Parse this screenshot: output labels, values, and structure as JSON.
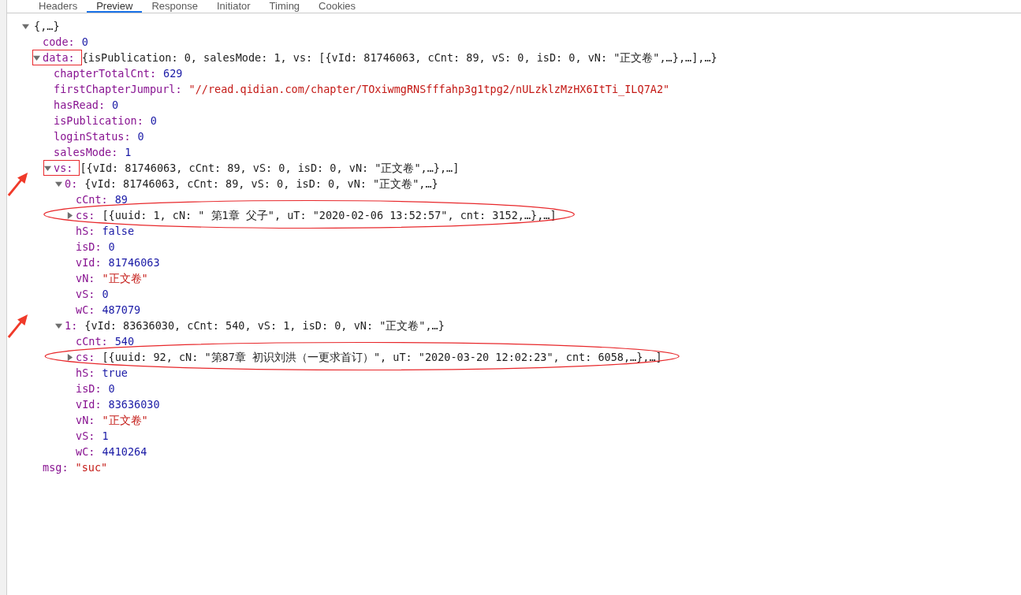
{
  "tabs": [
    {
      "label": "Headers",
      "selected": false
    },
    {
      "label": "Preview",
      "selected": true
    },
    {
      "label": "Response",
      "selected": false
    },
    {
      "label": "Initiator",
      "selected": false
    },
    {
      "label": "Timing",
      "selected": false
    },
    {
      "label": "Cookies",
      "selected": false
    }
  ],
  "tree": {
    "value": "{,…}",
    "kind": "object",
    "expanded": true,
    "children": [
      {
        "key": "code:",
        "value": "0",
        "kind": "number"
      },
      {
        "key": "data:",
        "value": "{isPublication: 0, salesMode: 1, vs: [{vId: 81746063, cCnt: 89, vS: 0, isD: 0, vN: \"正文卷\",…},…],…}",
        "kind": "object",
        "expanded": true,
        "boxed": true,
        "children": [
          {
            "key": "chapterTotalCnt:",
            "value": "629",
            "kind": "number"
          },
          {
            "key": "firstChapterJumpurl:",
            "value": "\"//read.qidian.com/chapter/TOxiwmgRNSfffahp3g1tpg2/nULzklzMzHX6ItTi_ILQ7A2\"",
            "kind": "string"
          },
          {
            "key": "hasRead:",
            "value": "0",
            "kind": "number"
          },
          {
            "key": "isPublication:",
            "value": "0",
            "kind": "number"
          },
          {
            "key": "loginStatus:",
            "value": "0",
            "kind": "number"
          },
          {
            "key": "salesMode:",
            "value": "1",
            "kind": "number"
          },
          {
            "key": "vs:",
            "value": "[{vId: 81746063, cCnt: 89, vS: 0, isD: 0, vN: \"正文卷\",…},…]",
            "kind": "object",
            "expanded": true,
            "boxed": true,
            "children": [
              {
                "key": "0:",
                "value": "{vId: 81746063, cCnt: 89, vS: 0, isD: 0, vN: \"正文卷\",…}",
                "kind": "object",
                "expanded": true,
                "arrow": true,
                "children": [
                  {
                    "key": "cCnt:",
                    "value": "89",
                    "kind": "number"
                  },
                  {
                    "key": "cs:",
                    "value": "[{uuid: 1, cN: \" 第1章  父子\", uT: \"2020-02-06 13:52:57\", cnt: 3152,…},…]",
                    "kind": "object",
                    "expanded": false,
                    "circled": true
                  },
                  {
                    "key": "hS:",
                    "value": "false",
                    "kind": "boolean"
                  },
                  {
                    "key": "isD:",
                    "value": "0",
                    "kind": "number"
                  },
                  {
                    "key": "vId:",
                    "value": "81746063",
                    "kind": "number"
                  },
                  {
                    "key": "vN:",
                    "value": "\"正文卷\"",
                    "kind": "string"
                  },
                  {
                    "key": "vS:",
                    "value": "0",
                    "kind": "number"
                  },
                  {
                    "key": "wC:",
                    "value": "487079",
                    "kind": "number"
                  }
                ]
              },
              {
                "key": "1:",
                "value": "{vId: 83636030, cCnt: 540, vS: 1, isD: 0, vN: \"正文卷\",…}",
                "kind": "object",
                "expanded": true,
                "arrow": true,
                "children": [
                  {
                    "key": "cCnt:",
                    "value": "540",
                    "kind": "number"
                  },
                  {
                    "key": "cs:",
                    "value": "[{uuid: 92, cN: \"第87章  初识刘洪（一更求首订）\", uT: \"2020-03-20 12:02:23\", cnt: 6058,…},…]",
                    "kind": "object",
                    "expanded": false,
                    "circled": true
                  },
                  {
                    "key": "hS:",
                    "value": "true",
                    "kind": "boolean"
                  },
                  {
                    "key": "isD:",
                    "value": "0",
                    "kind": "number"
                  },
                  {
                    "key": "vId:",
                    "value": "83636030",
                    "kind": "number"
                  },
                  {
                    "key": "vN:",
                    "value": "\"正文卷\"",
                    "kind": "string"
                  },
                  {
                    "key": "vS:",
                    "value": "1",
                    "kind": "number"
                  },
                  {
                    "key": "wC:",
                    "value": "4410264",
                    "kind": "number"
                  }
                ]
              }
            ]
          }
        ]
      },
      {
        "key": "msg:",
        "value": "\"suc\"",
        "kind": "string"
      }
    ]
  }
}
